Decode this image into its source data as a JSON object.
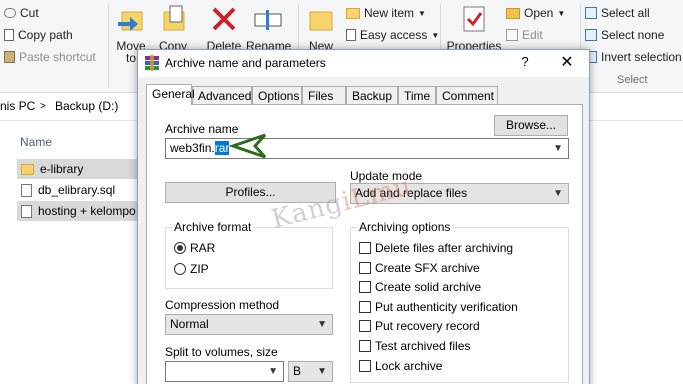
{
  "ribbon": {
    "cut": "Cut",
    "copy_path": "Copy path",
    "paste_shortcut": "Paste shortcut",
    "move_to": "Move",
    "move_to_line2": "to",
    "copy_to": "Copy",
    "delete": "Delete",
    "rename": "Rename",
    "new_folder": "New",
    "new_item": "New item",
    "easy_access": "Easy access",
    "properties": "Properties",
    "open": "Open",
    "edit": "Edit",
    "select_all": "Select all",
    "select_none": "Select none",
    "invert_selection": "Invert selection",
    "select_group": "Select"
  },
  "address": {
    "this_pc": "nis PC",
    "sep": ">",
    "drive": "Backup (D:)"
  },
  "files": {
    "column_name": "Name",
    "items": [
      {
        "name": "e-library",
        "type": "folder"
      },
      {
        "name": "db_elibrary.sql",
        "type": "file"
      },
      {
        "name": "hosting + kelompo",
        "type": "file"
      }
    ]
  },
  "dialog": {
    "title": "Archive name and parameters",
    "help": "?",
    "close": "✕",
    "tabs": [
      "General",
      "Advanced",
      "Options",
      "Files",
      "Backup",
      "Time",
      "Comment"
    ],
    "archive_name_label": "Archive name",
    "archive_name_base": "web3fin.",
    "archive_name_ext": "rar",
    "browse": "Browse...",
    "update_mode_label": "Update mode",
    "update_mode_value": "Add and replace files",
    "profiles": "Profiles...",
    "archive_format_label": "Archive format",
    "format_rar": "RAR",
    "format_zip": "ZIP",
    "selected_format": "RAR",
    "compression_label": "Compression method",
    "compression_value": "Normal",
    "split_label": "Split to volumes, size",
    "split_unit": "B",
    "archiving_options_label": "Archiving options",
    "options": [
      "Delete files after archiving",
      "Create SFX archive",
      "Create solid archive",
      "Put authenticity verification",
      "Put recovery record",
      "Test archived files",
      "Lock archive"
    ]
  },
  "watermark": {
    "part1": "Kang",
    "part2": "iLmu"
  },
  "colors": {
    "accent": "#0078d7",
    "arrow": "#2e6b1f",
    "folder": "#f7d36b"
  }
}
